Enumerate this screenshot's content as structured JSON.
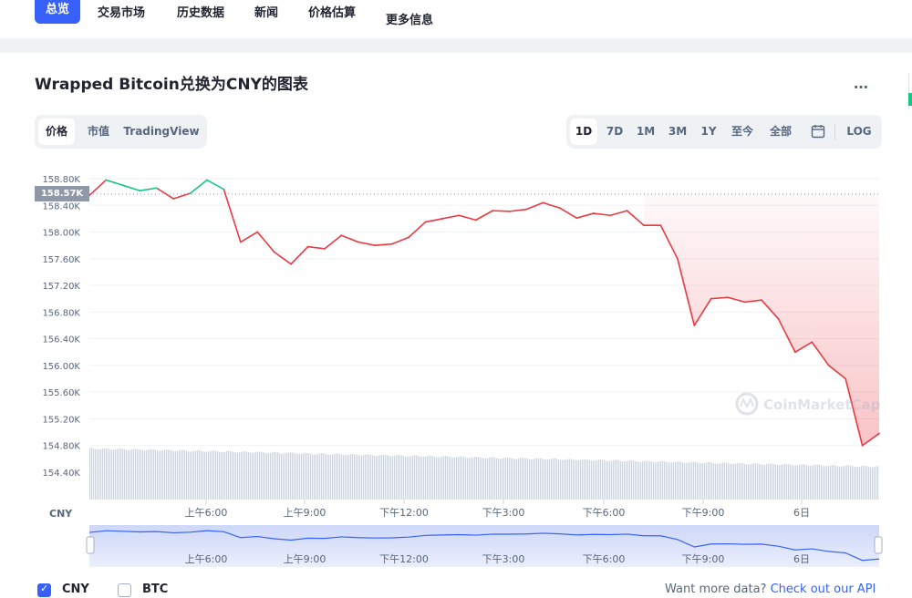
{
  "nav": {
    "items": [
      "总览",
      "交易市场",
      "历史数据",
      "新闻",
      "价格估算",
      "更多信息"
    ]
  },
  "title": "Wrapped Bitcoin兑换为CNY的图表",
  "more_icon": "…",
  "chart_tabs": [
    "价格",
    "市值",
    "TradingView"
  ],
  "range_tabs": [
    "1D",
    "7D",
    "1M",
    "3M",
    "1Y",
    "至今",
    "全部"
  ],
  "calendar_icon": "calendar-icon",
  "log_label": "LOG",
  "current_price_label": "158.57K",
  "currency_axis_label": "CNY",
  "watermark": "CoinMarketCap",
  "footer": {
    "cny": "CNY",
    "btc": "BTC",
    "api_prefix": "Want more data? ",
    "api_link": "Check out our API"
  },
  "colors": {
    "accent": "#3861fb",
    "up": "#16c784",
    "down": "#ea3943"
  },
  "chart_data": {
    "type": "line",
    "ylabel": "CNY",
    "ylim": [
      154.2,
      158.9
    ],
    "yticks": [
      "158.80K",
      "158.40K",
      "158.00K",
      "157.60K",
      "157.20K",
      "156.80K",
      "156.40K",
      "156.00K",
      "155.60K",
      "155.20K",
      "154.80K",
      "154.40K"
    ],
    "xticks": [
      "上午6:00",
      "上午9:00",
      "下午12:00",
      "下午3:00",
      "下午6:00",
      "下午9:00",
      "6日"
    ],
    "reference_price": 158.57,
    "x": [
      "上午3:00",
      "上午3:30",
      "上午4:00",
      "上午4:30",
      "上午5:00",
      "上午5:30",
      "上午6:00",
      "上午6:30",
      "上午7:00",
      "上午7:30",
      "上午8:00",
      "上午8:30",
      "上午9:00",
      "上午9:30",
      "上午10:00",
      "上午10:30",
      "上午11:00",
      "上午11:30",
      "下午12:00",
      "下午12:30",
      "下午1:00",
      "下午1:30",
      "下午2:00",
      "下午2:30",
      "下午3:00",
      "下午3:30",
      "下午4:00",
      "下午4:30",
      "下午5:00",
      "下午5:30",
      "下午6:00",
      "下午6:30",
      "下午7:00",
      "下午7:30",
      "下午8:00",
      "下午8:30",
      "下午9:00",
      "下午9:30",
      "下午10:00",
      "下午10:30",
      "下午11:00",
      "下午11:30",
      "6日",
      "上午0:30",
      "上午1:00",
      "上午1:30",
      "上午2:00",
      "上午2:30"
    ],
    "series": [
      {
        "values": [
          158.55,
          158.78,
          158.7,
          158.62,
          158.66,
          158.5,
          158.58,
          158.78,
          158.64,
          157.85,
          158.0,
          157.7,
          157.52,
          157.78,
          157.75,
          157.95,
          157.85,
          157.8,
          157.82,
          157.92,
          158.15,
          158.2,
          158.25,
          158.18,
          158.32,
          158.31,
          158.34,
          158.44,
          158.36,
          158.21,
          158.28,
          158.25,
          158.32,
          158.1,
          158.1,
          157.6,
          156.6,
          157.0,
          157.02,
          156.95,
          156.98,
          156.7,
          156.2,
          156.35,
          156.0,
          155.8,
          154.8,
          154.98
        ]
      }
    ],
    "area_fill_from": "下午7:30"
  }
}
